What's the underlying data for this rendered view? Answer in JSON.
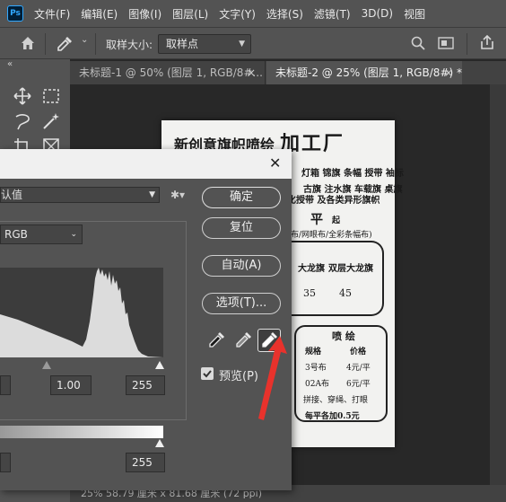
{
  "app": {
    "logo": "Ps",
    "menu": [
      "文件(F)",
      "编辑(E)",
      "图像(I)",
      "图层(L)",
      "文字(Y)",
      "选择(S)",
      "滤镜(T)",
      "3D(D)",
      "视图"
    ]
  },
  "options_bar": {
    "sample_size_label": "取样大小:",
    "sample_size_value": "取样点"
  },
  "tabs": [
    {
      "label": "未标题-1 @ 50% (图层 1, RGB/8#...",
      "close": "×",
      "active": false
    },
    {
      "label": "未标题-2 @ 25% (图层 1, RGB/8#) *",
      "close": "×",
      "active": true
    }
  ],
  "status": {
    "text": "25%    58.79 厘米 x 81.68 厘米 (72 ppi)"
  },
  "flyer": {
    "title": "新创意旗帜喷绘",
    "title_big": "加工厂",
    "line1": "灯箱 锦旗 条幅 授带 袖标",
    "line2": "古旗 注水旗 车载旗 桌旗",
    "line3": "化授带 及各类异形旗帜",
    "price_mark": "平",
    "price_unit": "起",
    "line4": "布/网眼布/全彩条幅布)",
    "table_head": [
      "大龙旗",
      "双层大龙旗"
    ],
    "table_vals": [
      "35",
      "45"
    ],
    "print_title": "喷 绘",
    "print_cols": [
      "规格",
      "价格"
    ],
    "print_rows": [
      [
        "3号布",
        "4元/平"
      ],
      [
        "02A布",
        "6元/平"
      ]
    ],
    "print_extra": "拼接、穿绳、打眼",
    "print_note": "每平各加0.5元"
  },
  "levels_dialog": {
    "close": "✕",
    "preset_value": "认值",
    "channel_value": "RGB",
    "input_black": "",
    "input_gamma": "1.00",
    "input_white": "255",
    "output_black": "",
    "output_white": "255",
    "buttons": {
      "ok": "确定",
      "reset": "复位",
      "auto": "自动(A)",
      "options": "选项(T)..."
    },
    "preview_label": "预览(P)",
    "preview_checked": true
  },
  "colors": {
    "accent_arrow": "#e8322c",
    "ui_dark": "#535353",
    "canvas_bg": "#282828"
  }
}
